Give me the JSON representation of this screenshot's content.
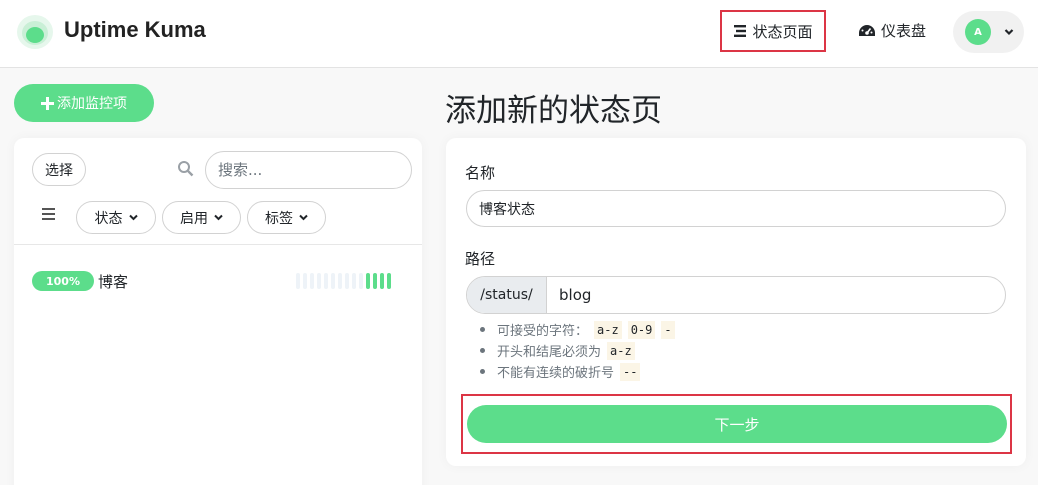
{
  "header": {
    "brand": "Uptime Kuma",
    "nav_status_label": "状态页面",
    "nav_dashboard_label": "仪表盘",
    "avatar_letter": "A"
  },
  "sidebar": {
    "add_monitor_label": "添加监控项",
    "select_label": "选择",
    "search_placeholder": "搜索...",
    "filters": [
      "状态",
      "启用",
      "标签"
    ],
    "monitors": [
      {
        "uptime": "100%",
        "name": "博客",
        "heartbeats_empty": 10,
        "heartbeats_up": 4
      }
    ]
  },
  "main": {
    "title": "添加新的状态页",
    "name_label": "名称",
    "name_value": "博客状态",
    "path_label": "路径",
    "path_prefix": "/status/",
    "path_value": "blog",
    "hints": {
      "accepted_label": "可接受的字符：",
      "accepted_codes": [
        "a-z",
        "0-9",
        "-"
      ],
      "start_end_label": "开头和结尾必须为",
      "start_end_code": "a-z",
      "no_dash_label": "不能有连续的破折号",
      "no_dash_code": "--"
    },
    "next_label": "下一步"
  },
  "colors": {
    "accent": "#5cdd8b",
    "highlight_border": "#dc3545"
  }
}
